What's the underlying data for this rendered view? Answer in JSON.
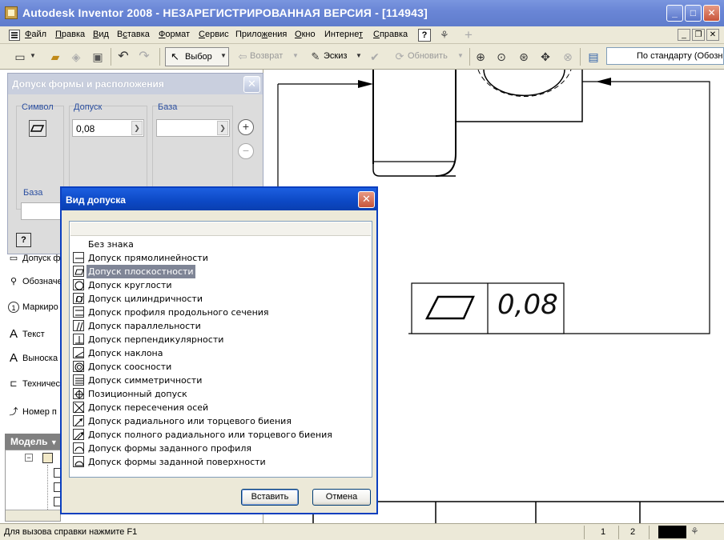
{
  "window": {
    "title": "Autodesk Inventor 2008 - НЕЗАРЕГИСТРИРОВАННАЯ ВЕРСИЯ - [114943]"
  },
  "menu": {
    "items": [
      {
        "pre": "",
        "u": "Ф",
        "post": "айл"
      },
      {
        "pre": "",
        "u": "П",
        "post": "равка"
      },
      {
        "pre": "",
        "u": "В",
        "post": "ид"
      },
      {
        "pre": "В",
        "u": "с",
        "post": "тавка"
      },
      {
        "pre": "",
        "u": "Ф",
        "post": "ормат"
      },
      {
        "pre": "",
        "u": "С",
        "post": "ервис"
      },
      {
        "pre": "Прило",
        "u": "ж",
        "post": "ения"
      },
      {
        "pre": "",
        "u": "О",
        "post": "кно"
      },
      {
        "pre": "Интерне",
        "u": "т",
        "post": ""
      },
      {
        "pre": "",
        "u": "С",
        "post": "правка"
      }
    ]
  },
  "toolbar": {
    "select_label": "Выбор",
    "back_label": "Возврат",
    "sketch_label": "Эскиз",
    "update_label": "Обновить",
    "style_value": "По стандарту (Обозн"
  },
  "panel": {
    "items": [
      "Допуск ф",
      "Обозначе",
      "Маркиро",
      "Текст",
      "Выноска",
      "Техничес",
      "Номер п"
    ],
    "model_label": "Модель"
  },
  "tolerance_dialog": {
    "title": "Допуск формы и расположения",
    "symbol_label": "Символ",
    "tolerance_label": "Допуск",
    "tolerance_value": "0,08",
    "datum_label": "База",
    "datum_label2": "База",
    "datum_value": ""
  },
  "type_dialog": {
    "title": "Вид допуска",
    "items": [
      "Без знака",
      "Допуск прямолинейности",
      "Допуск плоскостности",
      "Допуск круглости",
      "Допуск цилиндричности",
      "Допуск профиля продольного сечения",
      "Допуск параллельности",
      "Допуск перпендикулярности",
      "Допуск наклона",
      "Допуск соосности",
      "Допуск симметричности",
      "Позиционный допуск",
      "Допуск пересечения осей",
      "Допуск радиального или торцевого биения",
      "Допуск полного радиального или торцевого биения",
      "Допуск формы заданного профиля",
      "Допуск формы заданной поверхности"
    ],
    "selected_index": 2,
    "insert_label": "Вставить",
    "cancel_label": "Отмена"
  },
  "drawing": {
    "fcf_value": "0,08"
  },
  "status": {
    "message": "Для вызова справки нажмите F1",
    "cell1": "1",
    "cell2": "2"
  }
}
